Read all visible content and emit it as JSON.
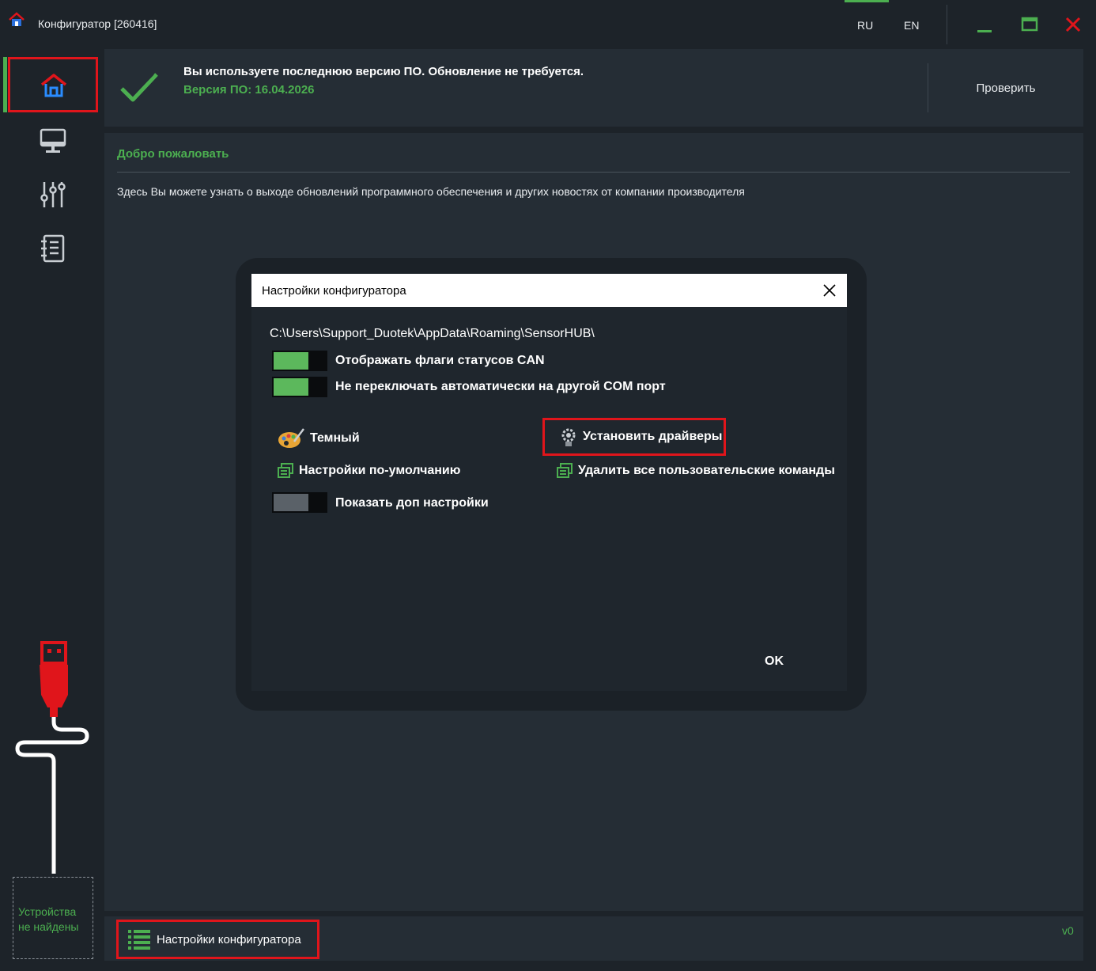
{
  "window": {
    "title": "Конфигуратор [260416]",
    "lang_ru": "RU",
    "lang_en": "EN",
    "active_lang": "RU"
  },
  "sidebar": {
    "items": [
      {
        "icon": "home-icon",
        "active": true
      },
      {
        "icon": "monitor-icon"
      },
      {
        "icon": "sliders-icon"
      },
      {
        "icon": "journal-icon"
      }
    ],
    "devices_status": "Устройства не найдены"
  },
  "update": {
    "message": "Вы используете последнюю версию ПО. Обновление не требуется.",
    "version": "Версия ПО: 16.04.2026",
    "check_button": "Проверить"
  },
  "welcome": {
    "title": "Добро пожаловать",
    "text": "Здесь Вы можете узнать о выходе обновлений программного обеспечения и других новостях от компании производителя"
  },
  "dialog": {
    "title": "Настройки конфигуратора",
    "path": "C:\\Users\\Support_Duotek\\AppData\\Roaming\\SensorHUB\\",
    "toggles": [
      {
        "label": "Отображать флаги статусов CAN",
        "on": true
      },
      {
        "label": "Не переключать автоматически на другой COM порт",
        "on": true
      },
      {
        "label": "Показать доп настройки",
        "on": false
      }
    ],
    "theme_label": "Темный",
    "defaults_label": "Настройки по-умолчанию",
    "install_drivers_label": "Установить драйверы",
    "delete_commands_label": "Удалить все пользовательские команды",
    "ok_label": "OK"
  },
  "bottom": {
    "settings_button": "Настройки конфигуратора",
    "version": "v0"
  },
  "colors": {
    "accent": "#4caf50",
    "highlight": "#e0151b",
    "background": "#1d2329",
    "panel": "#252d35"
  }
}
